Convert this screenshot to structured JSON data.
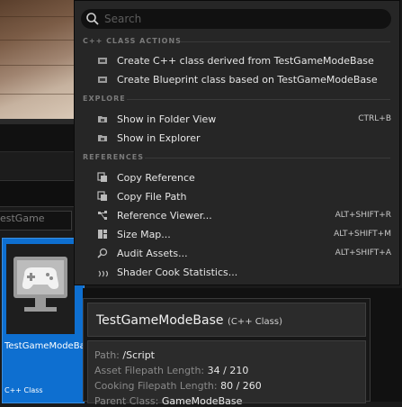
{
  "search": {
    "placeholder": "Search",
    "value": ""
  },
  "sections": [
    {
      "title": "C++ CLASS ACTIONS"
    },
    {
      "title": "EXPLORE"
    },
    {
      "title": "REFERENCES"
    }
  ],
  "menu_items": [
    {
      "label": "Create C++ class derived from TestGameModeBase",
      "shortcut": "",
      "icon": "cpp-class-icon"
    },
    {
      "label": "Create Blueprint class based on TestGameModeBase",
      "shortcut": "",
      "icon": "blueprint-class-icon"
    },
    {
      "label": "Show in Folder View",
      "shortcut": "CTRL+B",
      "icon": "folder-icon"
    },
    {
      "label": "Show in Explorer",
      "shortcut": "",
      "icon": "explorer-folder-icon"
    },
    {
      "label": "Copy Reference",
      "shortcut": "",
      "icon": "copy-reference-icon"
    },
    {
      "label": "Copy File Path",
      "shortcut": "",
      "icon": "copy-file-path-icon"
    },
    {
      "label": "Reference Viewer...",
      "shortcut": "ALT+SHIFT+R",
      "icon": "reference-viewer-icon"
    },
    {
      "label": "Size Map...",
      "shortcut": "ALT+SHIFT+M",
      "icon": "size-map-icon"
    },
    {
      "label": "Audit Assets...",
      "shortcut": "ALT+SHIFT+A",
      "icon": "audit-assets-icon"
    },
    {
      "label": "Shader Cook Statistics...",
      "shortcut": "",
      "icon": "shader-cook-icon"
    }
  ],
  "background": {
    "path_fragment": "estGame",
    "asset": {
      "name": "TestGameModeBase",
      "type": "C++ Class"
    }
  },
  "tooltip": {
    "title": "TestGameModeBase",
    "subtitle": "(C++ Class)",
    "path_label": "Path:",
    "path_value": "/Script",
    "asset_len_label": "Asset Filepath Length:",
    "asset_len_value": "34 / 210",
    "cook_len_label": "Cooking Filepath Length:",
    "cook_len_value": "80 / 260",
    "parent_label": "Parent Class:",
    "parent_value": "GameModeBase"
  },
  "colors": {
    "selection": "#0e6fd0",
    "menu_bg": "#262626",
    "tooltip_bg": "#2b2b2b"
  }
}
